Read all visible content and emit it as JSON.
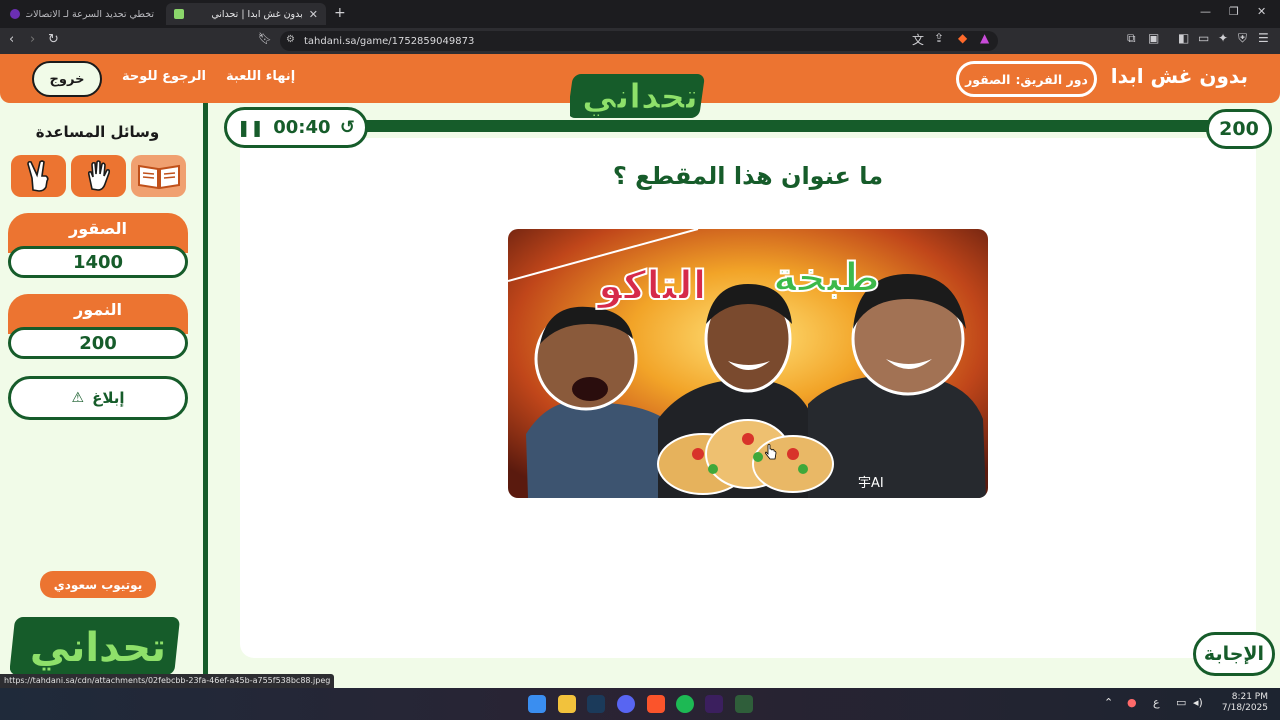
{
  "browser": {
    "tabs": [
      {
        "title": "تخطي تحديد السرعة لـ الاتصالات السعو",
        "active": false
      },
      {
        "title": "بدون غش ابدا | تحداني",
        "active": true
      }
    ],
    "url": "tahdani.sa/game/1752859049873",
    "status_url": "https://tahdani.sa/cdn/attachments/02febcbb-23fa-46ef-a45b-a755f538bc88.jpeg"
  },
  "header": {
    "brand": "بدون غش ابدا",
    "turn_label": "دور الفريق:",
    "turn_team": "الصقور",
    "logo_text": "تحداني",
    "end_game": "إنهاء اللعبة",
    "back_to_board": "الرجوع للوحة",
    "exit": "خروج"
  },
  "sidebar": {
    "aids_title": "وسائل المساعدة",
    "aids": [
      {
        "icon": "open-book-icon",
        "enabled": false
      },
      {
        "icon": "raised-hand-icon",
        "enabled": true
      },
      {
        "icon": "two-fingers-icon",
        "enabled": true
      }
    ],
    "teams": [
      {
        "name": "الصقور",
        "score": "1400"
      },
      {
        "name": "النمور",
        "score": "200"
      }
    ],
    "report": "إبلاغ",
    "channel": "يوتيوب سعودي",
    "logo_text": "تحداني"
  },
  "game": {
    "timer": "00:40",
    "points": "200",
    "question": "ما عنوان هذا المقطع ؟",
    "image_text_left": "طبخة",
    "image_text_right": "التاكو",
    "image_shirt_text": "宇AI",
    "answer": "الإجابة"
  },
  "taskbar": {
    "time": "8:21 PM",
    "date": "7/18/2025",
    "lang": "ع"
  },
  "colors": {
    "orange": "#ec7431",
    "green": "#165c2a",
    "mint": "#f1fbe8"
  }
}
